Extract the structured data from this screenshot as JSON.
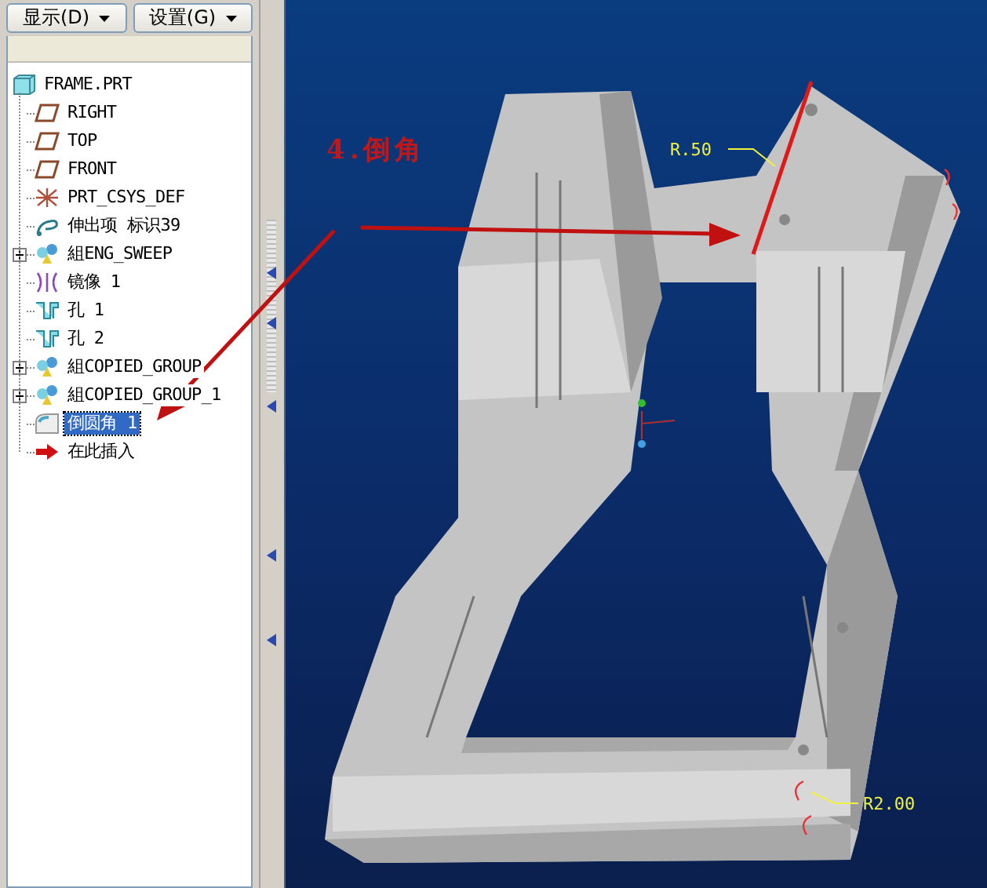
{
  "toolbar": {
    "buttons": [
      {
        "label": "显示(D)"
      },
      {
        "label": "设置(G)"
      }
    ]
  },
  "model_tree": {
    "root": {
      "label": "FRAME.PRT",
      "kind": "part",
      "children": [
        {
          "label": "RIGHT",
          "kind": "plane",
          "collapsed": false,
          "selected": false
        },
        {
          "label": "TOP",
          "kind": "plane",
          "collapsed": false,
          "selected": false
        },
        {
          "label": "FRONT",
          "kind": "plane",
          "collapsed": false,
          "selected": false
        },
        {
          "label": "PRT_CSYS_DEF",
          "kind": "csys",
          "collapsed": false,
          "selected": false
        },
        {
          "label": "伸出项 标识39",
          "kind": "protrusion",
          "collapsed": false,
          "selected": false
        },
        {
          "label": "組ENG_SWEEP",
          "kind": "group",
          "collapsed": true,
          "selected": false
        },
        {
          "label": "镜像 1",
          "kind": "mirror",
          "collapsed": false,
          "selected": false
        },
        {
          "label": "孔 1",
          "kind": "hole",
          "collapsed": false,
          "selected": false
        },
        {
          "label": "孔 2",
          "kind": "hole",
          "collapsed": false,
          "selected": false
        },
        {
          "label": "組COPIED_GROUP",
          "kind": "group",
          "collapsed": true,
          "selected": false
        },
        {
          "label": "組COPIED_GROUP_1",
          "kind": "group",
          "collapsed": true,
          "selected": false
        },
        {
          "label": "倒圆角 1",
          "kind": "round",
          "collapsed": false,
          "selected": true
        },
        {
          "label": "在此插入",
          "kind": "insert",
          "collapsed": false,
          "selected": false
        }
      ]
    }
  },
  "viewport": {
    "annotations": [
      {
        "kind": "callout",
        "text": "4.倒角"
      },
      {
        "kind": "dimension",
        "text": "R.50"
      },
      {
        "kind": "dimension",
        "text": "R2.00"
      }
    ]
  }
}
